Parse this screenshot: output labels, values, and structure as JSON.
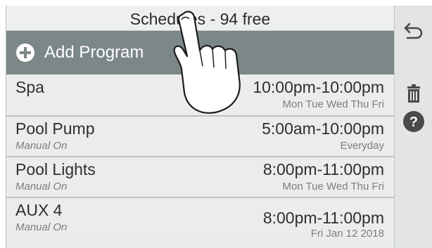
{
  "header": {
    "title": "Schedules - 94 free"
  },
  "add_program": {
    "label": "Add Program",
    "icon": "plus-circle-icon"
  },
  "schedules": [
    {
      "name": "Spa",
      "mode": "",
      "time": "10:00pm-10:00pm",
      "days": "Mon Tue Wed Thu Fri"
    },
    {
      "name": "Pool Pump",
      "mode": "Manual On",
      "time": "5:00am-10:00pm",
      "days": "Everyday"
    },
    {
      "name": "Pool Lights",
      "mode": "Manual On",
      "time": "8:00pm-11:00pm",
      "days": "Mon Tue Wed Thu Fri"
    },
    {
      "name": "AUX 4",
      "mode": "Manual On",
      "time": "8:00pm-11:00pm",
      "days": "Fri Jan 12 2018"
    }
  ],
  "sidebar": {
    "back_icon": "back-arrow-icon",
    "delete_icon": "trash-icon",
    "help_icon": "help-icon"
  },
  "colors": {
    "add_bar": "#7c8788",
    "row_bg": "#ececec",
    "header_bg": "#eef0f0",
    "icon_dark": "#4a4a4a"
  }
}
